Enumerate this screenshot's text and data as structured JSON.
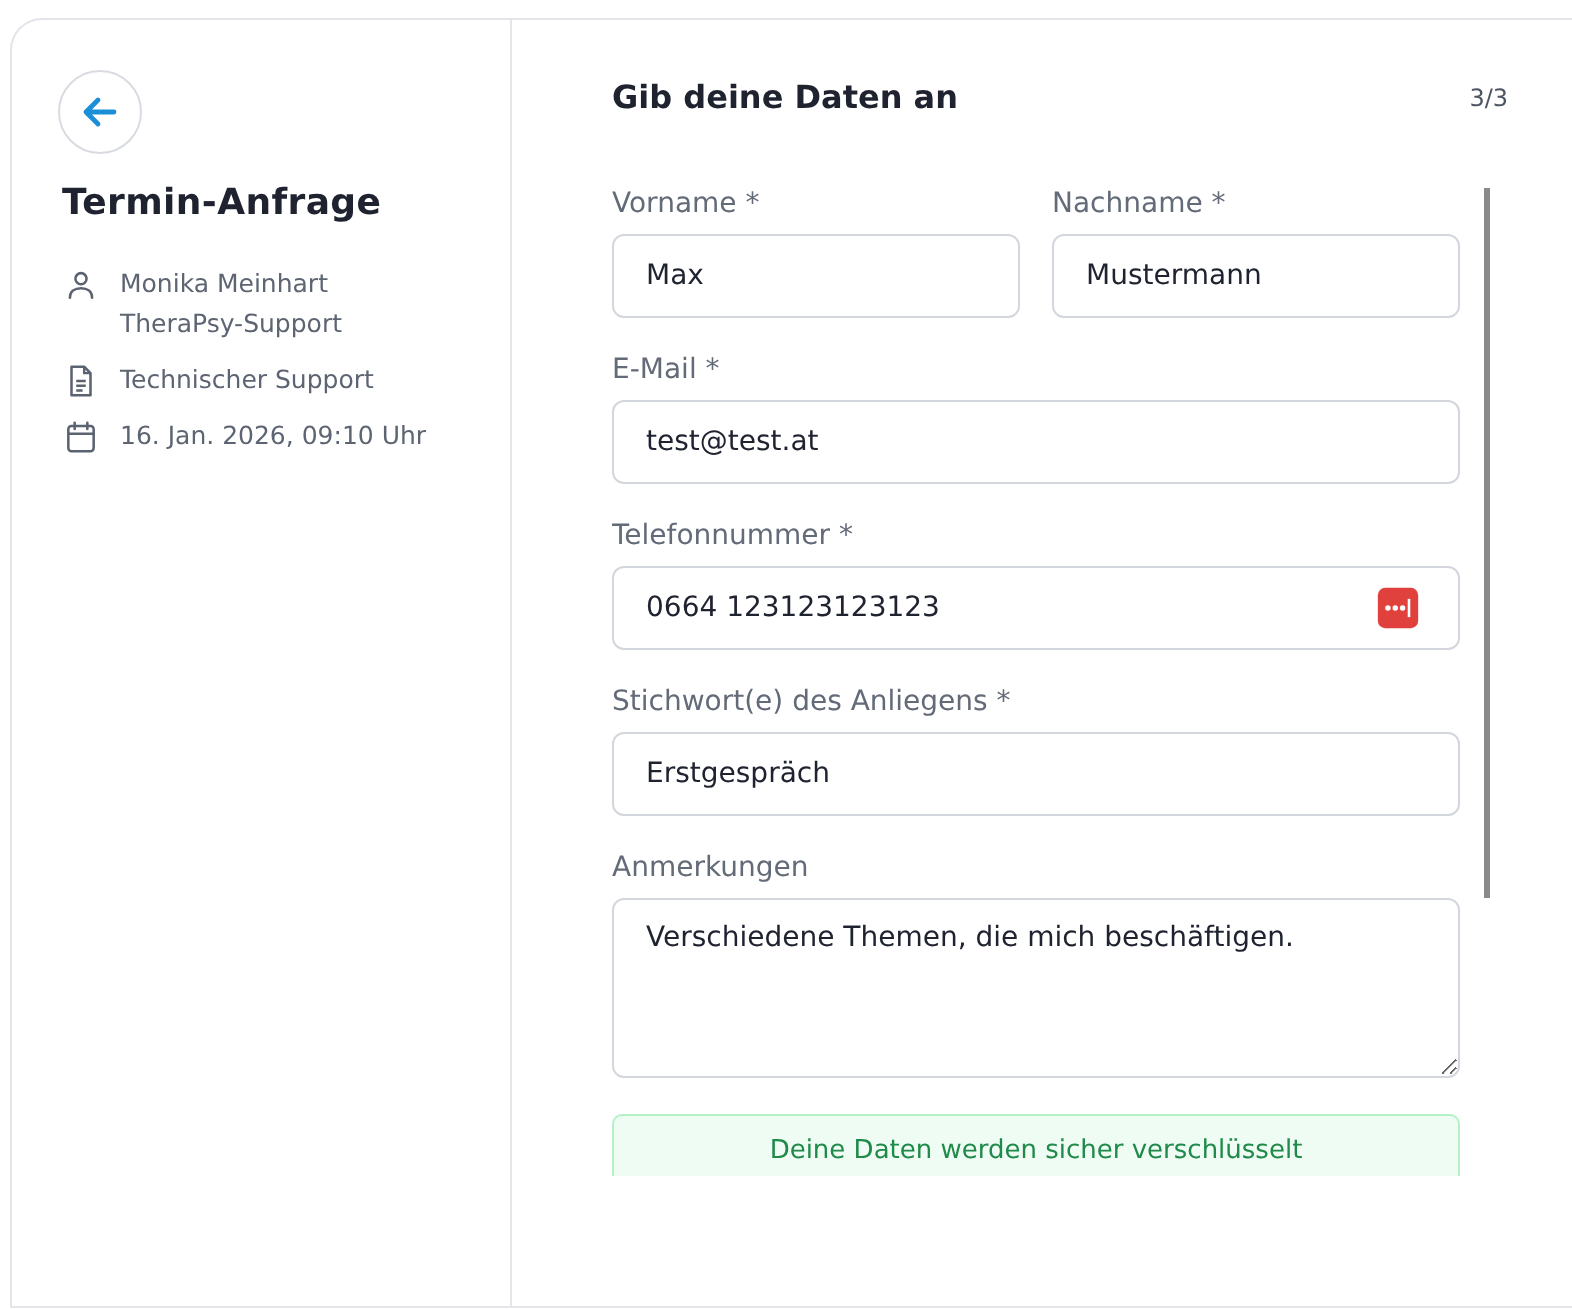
{
  "sidebar": {
    "title": "Termin-Anfrage",
    "details": [
      {
        "kind": "person",
        "lines": [
          "Monika Meinhart",
          "TheraPsy-Support"
        ]
      },
      {
        "kind": "document",
        "lines": [
          "Technischer Support"
        ]
      },
      {
        "kind": "calendar",
        "lines": [
          "16. Jan. 2026, 09:10 Uhr"
        ]
      }
    ]
  },
  "form": {
    "title": "Gib deine Daten an",
    "step": "3/3",
    "rows": [
      [
        {
          "label": "Vorname *",
          "value": "Max",
          "kind": "text"
        },
        {
          "label": "Nachname *",
          "value": "Mustermann",
          "kind": "text"
        }
      ],
      [
        {
          "label": "E-Mail *",
          "value": "test@test.at",
          "kind": "text"
        }
      ],
      [
        {
          "label": "Telefonnummer *",
          "value": "0664 123123123123",
          "kind": "phone"
        }
      ],
      [
        {
          "label": "Stichwort(e) des Anliegens *",
          "value": "Erstgespräch",
          "kind": "text"
        }
      ],
      [
        {
          "label": "Anmerkungen",
          "value": "Verschiedene Themen, die mich beschäftigen.",
          "kind": "textarea"
        }
      ]
    ],
    "notice": "Deine Daten werden sicher verschlüsselt"
  }
}
